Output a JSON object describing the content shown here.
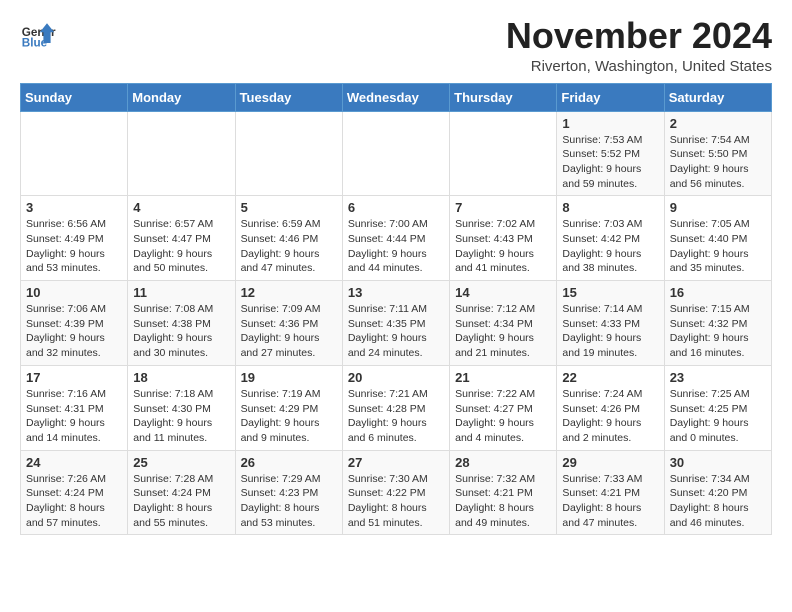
{
  "logo": {
    "line1": "General",
    "line2": "Blue"
  },
  "title": "November 2024",
  "location": "Riverton, Washington, United States",
  "days_of_week": [
    "Sunday",
    "Monday",
    "Tuesday",
    "Wednesday",
    "Thursday",
    "Friday",
    "Saturday"
  ],
  "weeks": [
    [
      {
        "day": "",
        "info": ""
      },
      {
        "day": "",
        "info": ""
      },
      {
        "day": "",
        "info": ""
      },
      {
        "day": "",
        "info": ""
      },
      {
        "day": "",
        "info": ""
      },
      {
        "day": "1",
        "info": "Sunrise: 7:53 AM\nSunset: 5:52 PM\nDaylight: 9 hours and 59 minutes."
      },
      {
        "day": "2",
        "info": "Sunrise: 7:54 AM\nSunset: 5:50 PM\nDaylight: 9 hours and 56 minutes."
      }
    ],
    [
      {
        "day": "3",
        "info": "Sunrise: 6:56 AM\nSunset: 4:49 PM\nDaylight: 9 hours and 53 minutes."
      },
      {
        "day": "4",
        "info": "Sunrise: 6:57 AM\nSunset: 4:47 PM\nDaylight: 9 hours and 50 minutes."
      },
      {
        "day": "5",
        "info": "Sunrise: 6:59 AM\nSunset: 4:46 PM\nDaylight: 9 hours and 47 minutes."
      },
      {
        "day": "6",
        "info": "Sunrise: 7:00 AM\nSunset: 4:44 PM\nDaylight: 9 hours and 44 minutes."
      },
      {
        "day": "7",
        "info": "Sunrise: 7:02 AM\nSunset: 4:43 PM\nDaylight: 9 hours and 41 minutes."
      },
      {
        "day": "8",
        "info": "Sunrise: 7:03 AM\nSunset: 4:42 PM\nDaylight: 9 hours and 38 minutes."
      },
      {
        "day": "9",
        "info": "Sunrise: 7:05 AM\nSunset: 4:40 PM\nDaylight: 9 hours and 35 minutes."
      }
    ],
    [
      {
        "day": "10",
        "info": "Sunrise: 7:06 AM\nSunset: 4:39 PM\nDaylight: 9 hours and 32 minutes."
      },
      {
        "day": "11",
        "info": "Sunrise: 7:08 AM\nSunset: 4:38 PM\nDaylight: 9 hours and 30 minutes."
      },
      {
        "day": "12",
        "info": "Sunrise: 7:09 AM\nSunset: 4:36 PM\nDaylight: 9 hours and 27 minutes."
      },
      {
        "day": "13",
        "info": "Sunrise: 7:11 AM\nSunset: 4:35 PM\nDaylight: 9 hours and 24 minutes."
      },
      {
        "day": "14",
        "info": "Sunrise: 7:12 AM\nSunset: 4:34 PM\nDaylight: 9 hours and 21 minutes."
      },
      {
        "day": "15",
        "info": "Sunrise: 7:14 AM\nSunset: 4:33 PM\nDaylight: 9 hours and 19 minutes."
      },
      {
        "day": "16",
        "info": "Sunrise: 7:15 AM\nSunset: 4:32 PM\nDaylight: 9 hours and 16 minutes."
      }
    ],
    [
      {
        "day": "17",
        "info": "Sunrise: 7:16 AM\nSunset: 4:31 PM\nDaylight: 9 hours and 14 minutes."
      },
      {
        "day": "18",
        "info": "Sunrise: 7:18 AM\nSunset: 4:30 PM\nDaylight: 9 hours and 11 minutes."
      },
      {
        "day": "19",
        "info": "Sunrise: 7:19 AM\nSunset: 4:29 PM\nDaylight: 9 hours and 9 minutes."
      },
      {
        "day": "20",
        "info": "Sunrise: 7:21 AM\nSunset: 4:28 PM\nDaylight: 9 hours and 6 minutes."
      },
      {
        "day": "21",
        "info": "Sunrise: 7:22 AM\nSunset: 4:27 PM\nDaylight: 9 hours and 4 minutes."
      },
      {
        "day": "22",
        "info": "Sunrise: 7:24 AM\nSunset: 4:26 PM\nDaylight: 9 hours and 2 minutes."
      },
      {
        "day": "23",
        "info": "Sunrise: 7:25 AM\nSunset: 4:25 PM\nDaylight: 9 hours and 0 minutes."
      }
    ],
    [
      {
        "day": "24",
        "info": "Sunrise: 7:26 AM\nSunset: 4:24 PM\nDaylight: 8 hours and 57 minutes."
      },
      {
        "day": "25",
        "info": "Sunrise: 7:28 AM\nSunset: 4:24 PM\nDaylight: 8 hours and 55 minutes."
      },
      {
        "day": "26",
        "info": "Sunrise: 7:29 AM\nSunset: 4:23 PM\nDaylight: 8 hours and 53 minutes."
      },
      {
        "day": "27",
        "info": "Sunrise: 7:30 AM\nSunset: 4:22 PM\nDaylight: 8 hours and 51 minutes."
      },
      {
        "day": "28",
        "info": "Sunrise: 7:32 AM\nSunset: 4:21 PM\nDaylight: 8 hours and 49 minutes."
      },
      {
        "day": "29",
        "info": "Sunrise: 7:33 AM\nSunset: 4:21 PM\nDaylight: 8 hours and 47 minutes."
      },
      {
        "day": "30",
        "info": "Sunrise: 7:34 AM\nSunset: 4:20 PM\nDaylight: 8 hours and 46 minutes."
      }
    ]
  ]
}
